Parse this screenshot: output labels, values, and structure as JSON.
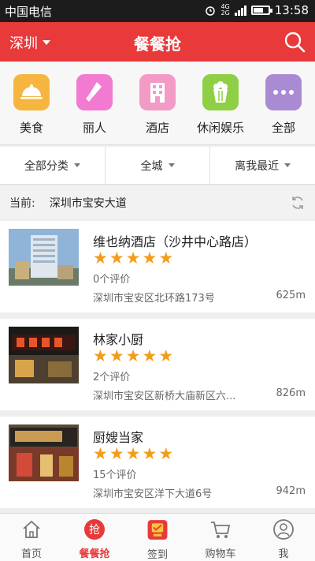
{
  "status_bar": {
    "carrier": "中国电信",
    "net_top": "4G",
    "net_bottom": "2G",
    "time": "13:58"
  },
  "header": {
    "city": "深圳",
    "title": "餐餐抢"
  },
  "categories": [
    {
      "label": "美食",
      "icon": "food-dish-icon",
      "color": "#f5b53f"
    },
    {
      "label": "丽人",
      "icon": "lipstick-icon",
      "color": "#f27ad0"
    },
    {
      "label": "酒店",
      "icon": "hotel-building-icon",
      "color": "#f39ac6"
    },
    {
      "label": "休闲娱乐",
      "icon": "popcorn-icon",
      "color": "#8fcf45"
    },
    {
      "label": "全部",
      "icon": "more-dots-icon",
      "color": "#a98bd4"
    }
  ],
  "filters": {
    "category": "全部分类",
    "area": "全城",
    "sort": "离我最近"
  },
  "location": {
    "prefix": "当前:",
    "address": "深圳市宝安大道"
  },
  "listings": [
    {
      "name": "维也纳酒店（沙井中心路店）",
      "rating": 5,
      "reviews": "0个评价",
      "address": "深圳市宝安区北环路173号",
      "distance": "625m"
    },
    {
      "name": "林家小厨",
      "rating": 5,
      "reviews": "2个评价",
      "address": "深圳市宝安区新桥大庙新区六...",
      "distance": "826m"
    },
    {
      "name": "厨嫂当家",
      "rating": 5,
      "reviews": "15个评价",
      "address": "深圳市宝安区洋下大道6号",
      "distance": "942m"
    }
  ],
  "bottom_nav": [
    {
      "label": "首页",
      "icon": "home-icon"
    },
    {
      "label": "餐餐抢",
      "icon": "qiang-icon",
      "badge": "抢"
    },
    {
      "label": "签到",
      "icon": "sign-in-icon"
    },
    {
      "label": "购物车",
      "icon": "cart-icon"
    },
    {
      "label": "我",
      "icon": "profile-icon"
    }
  ],
  "colors": {
    "brand_red": "#e83a3a",
    "star": "#f39c1a"
  }
}
